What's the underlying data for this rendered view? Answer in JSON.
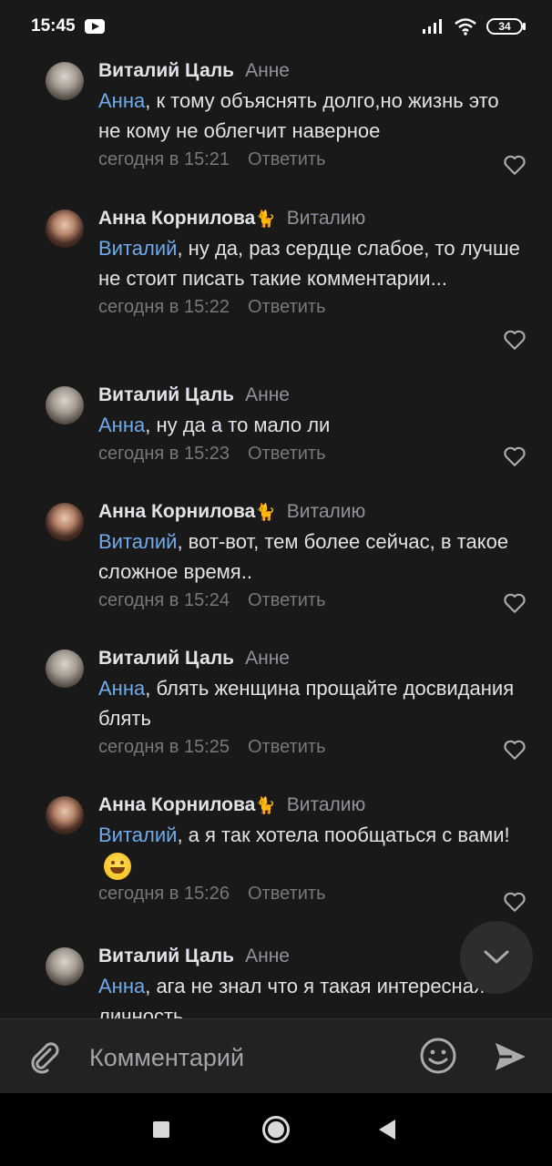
{
  "status_bar": {
    "time": "15:45",
    "battery": "34"
  },
  "comments": [
    {
      "author": "Виталий Цаль",
      "reply_to": "Анне",
      "mention": "Анна",
      "text": ", к тому объяснять долго,но жизнь это не кому не облегчит наверное",
      "time": "сегодня в 15:21",
      "reply_label": "Ответить"
    },
    {
      "author": "Анна Корнилова",
      "author_emoji": "🐈",
      "reply_to": "Виталию",
      "mention": "Виталий",
      "text": ", ну да, раз сердце слабое, то лучше не стоит писать такие комментарии...",
      "time": "сегодня в 15:22",
      "reply_label": "Ответить"
    },
    {
      "author": "Виталий Цаль",
      "reply_to": "Анне",
      "mention": "Анна",
      "text": ", ну да а то мало ли",
      "time": "сегодня в 15:23",
      "reply_label": "Ответить"
    },
    {
      "author": "Анна Корнилова",
      "author_emoji": "🐈",
      "reply_to": "Виталию",
      "mention": "Виталий",
      "text": ", вот-вот, тем более сейчас, в такое сложное время..",
      "time": "сегодня в 15:24",
      "reply_label": "Ответить"
    },
    {
      "author": "Виталий Цаль",
      "reply_to": "Анне",
      "mention": "Анна",
      "text": ", блять женщина прощайте досвидания блять",
      "time": "сегодня в 15:25",
      "reply_label": "Ответить"
    },
    {
      "author": "Анна Корнилова",
      "author_emoji": "🐈",
      "reply_to": "Виталию",
      "mention": "Виталий",
      "text": ", а я так хотела пообщаться с вами!",
      "text_emoji": "grinning-face-emoji",
      "time": "сегодня в 15:26",
      "reply_label": "Ответить"
    },
    {
      "author": "Виталий Цаль",
      "reply_to": "Анне",
      "mention": "Анна",
      "text": ", ага не знал что я такая интересная личность"
    }
  ],
  "composer": {
    "placeholder": "Комментарий"
  },
  "colors": {
    "background": "#19191a",
    "mention": "#71aaeb",
    "meta": "#76787a"
  }
}
